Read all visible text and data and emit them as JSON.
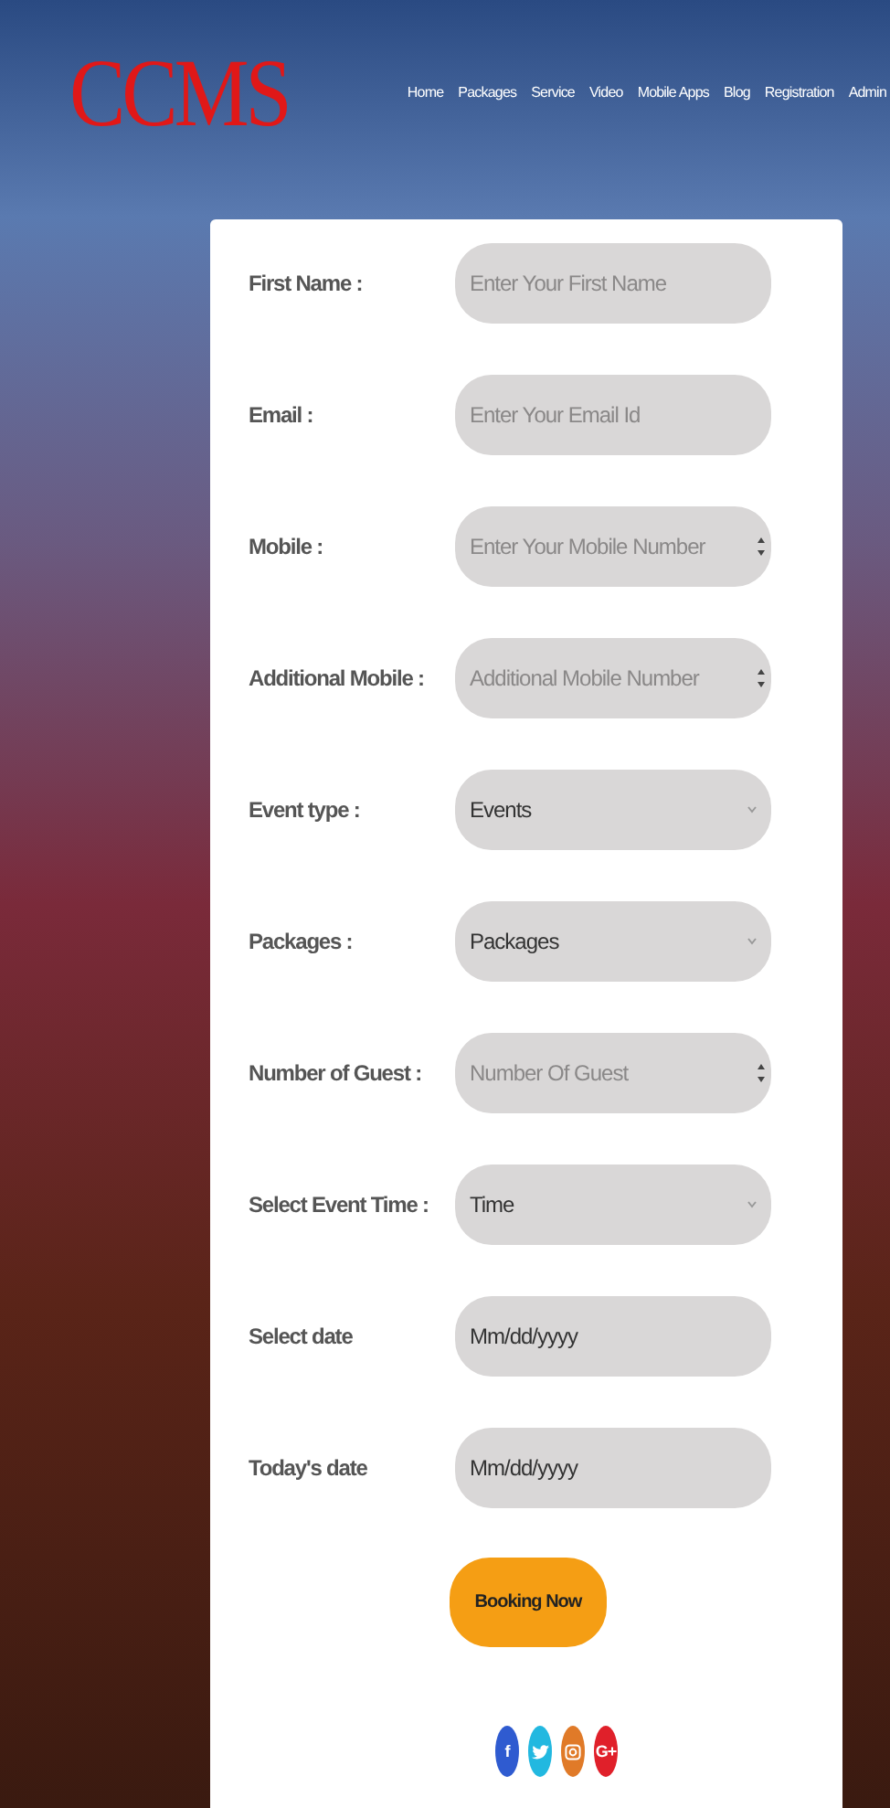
{
  "logo": "CCMS",
  "nav": [
    "Home",
    "Packages",
    "Service",
    "Video",
    "Mobile Apps",
    "Blog",
    "Registration",
    "Admin"
  ],
  "form": {
    "fields": [
      {
        "label": "First Name :",
        "kind": "text",
        "placeholder": "Enter Your First Name"
      },
      {
        "label": "Email :",
        "kind": "text",
        "placeholder": "Enter Your Email Id"
      },
      {
        "label": "Mobile :",
        "kind": "number",
        "placeholder": "Enter Your Mobile Number"
      },
      {
        "label": "Additional Mobile :",
        "kind": "number",
        "placeholder": "Additional Mobile Number"
      },
      {
        "label": "Event type :",
        "kind": "select",
        "value": "Events"
      },
      {
        "label": "Packages :",
        "kind": "select",
        "value": "Packages"
      },
      {
        "label": "Number of Guest :",
        "kind": "number",
        "placeholder": "Number Of Guest"
      },
      {
        "label": "Select Event Time :",
        "kind": "select",
        "value": "Time"
      },
      {
        "label": "Select date",
        "kind": "date",
        "value": "Mm/dd/yyyy"
      },
      {
        "label": "Today's date",
        "kind": "date",
        "value": "Mm/dd/yyyy"
      }
    ],
    "submit": "Booking Now",
    "social": [
      {
        "kind": "facebook",
        "glyph": "f",
        "color": "#2f5bd0"
      },
      {
        "kind": "twitter",
        "color": "#22b8e0"
      },
      {
        "kind": "instagram",
        "color": "#e07a28"
      },
      {
        "kind": "googleplus",
        "glyph": "G+",
        "color": "#e0202a"
      }
    ]
  }
}
